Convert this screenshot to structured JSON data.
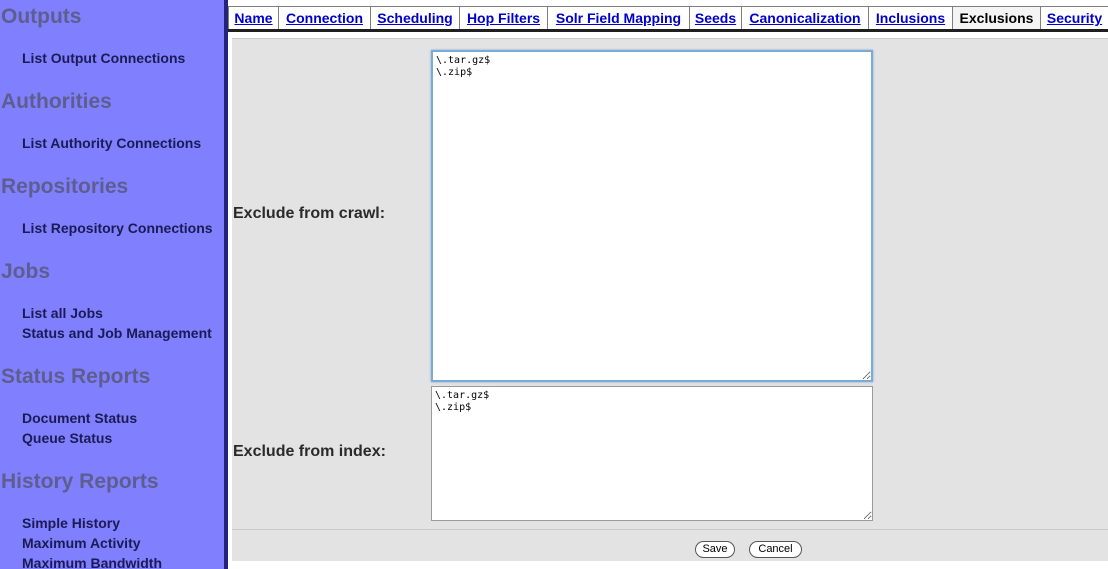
{
  "sidebar": {
    "sections": [
      {
        "heading": "Outputs",
        "links": [
          "List Output Connections"
        ]
      },
      {
        "heading": "Authorities",
        "links": [
          "List Authority Connections"
        ]
      },
      {
        "heading": "Repositories",
        "links": [
          "List Repository Connections"
        ]
      },
      {
        "heading": "Jobs",
        "links": [
          "List all Jobs",
          "Status and Job Management"
        ]
      },
      {
        "heading": "Status Reports",
        "links": [
          "Document Status",
          "Queue Status"
        ]
      },
      {
        "heading": "History Reports",
        "links": [
          "Simple History",
          "Maximum Activity",
          "Maximum Bandwidth"
        ]
      }
    ]
  },
  "tabs": [
    {
      "label": "Name",
      "active": false
    },
    {
      "label": "Connection",
      "active": false
    },
    {
      "label": "Scheduling",
      "active": false
    },
    {
      "label": "Hop Filters",
      "active": false
    },
    {
      "label": "Solr Field Mapping",
      "active": false
    },
    {
      "label": "Seeds",
      "active": false
    },
    {
      "label": "Canonicalization",
      "active": false
    },
    {
      "label": "Inclusions",
      "active": false
    },
    {
      "label": "Exclusions",
      "active": true
    },
    {
      "label": "Security",
      "active": false
    }
  ],
  "form": {
    "crawl_label": "Exclude from crawl:",
    "crawl_value": "\\.tar.gz$\n\\.zip$",
    "index_label": "Exclude from index:",
    "index_value": "\\.tar.gz$\n\\.zip$"
  },
  "buttons": {
    "save": "Save",
    "cancel": "Cancel"
  }
}
